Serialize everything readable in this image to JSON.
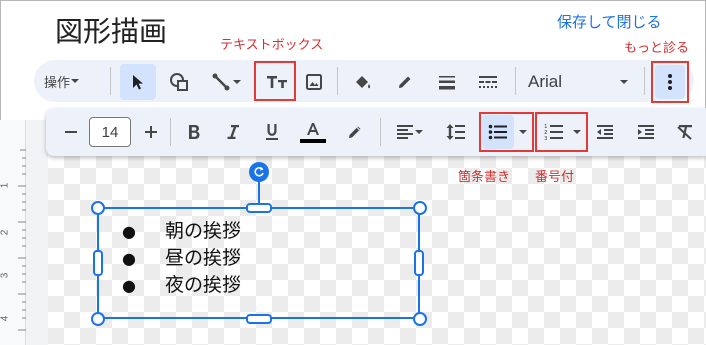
{
  "document": {
    "title": "図形描画",
    "save_close": "保存して閉じる"
  },
  "annotations": {
    "textbox_tool": "テキストボックス",
    "more": "もっと診る",
    "bullet_list": "箇条書き",
    "numbered_list": "番号付"
  },
  "toolbar": {
    "actions_label": "操作",
    "font_name": "Arial",
    "font_size": "14"
  },
  "textbox": {
    "items": [
      "朝の挨拶",
      "昼の挨拶",
      "夜の挨拶"
    ]
  },
  "ruler": {
    "labels": [
      "1",
      "2",
      "3",
      "4"
    ]
  },
  "colors": {
    "accent": "#1a73e8",
    "annotation": "#e53935",
    "toolbar_bg": "#edf2fa",
    "active_bg": "#d3e3fd"
  },
  "icons": {
    "select": "cursor-arrow-icon",
    "shape": "shape-icon",
    "line": "line-icon",
    "textbox": "text-box-icon",
    "image": "image-icon",
    "fill": "paint-bucket-icon",
    "pen": "pencil-icon",
    "border_weight": "line-weight-icon",
    "border_dash": "line-dash-icon",
    "more": "more-vert-icon",
    "bold": "bold-icon",
    "italic": "italic-icon",
    "underline": "underline-icon",
    "text_color": "text-color-icon",
    "highlight": "highlight-icon",
    "align": "align-icon",
    "line_spacing": "line-spacing-icon",
    "bulleted": "bulleted-list-icon",
    "numbered": "numbered-list-icon",
    "outdent": "decrease-indent-icon",
    "indent": "increase-indent-icon",
    "clear_format": "clear-formatting-icon",
    "rotate": "rotate-handle-icon"
  }
}
